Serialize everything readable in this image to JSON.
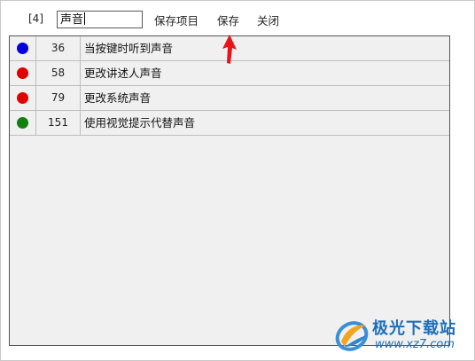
{
  "toolbar": {
    "count_label": "[4]",
    "search_value": "声音",
    "save_item_label": "保存项目",
    "save_label": "保存",
    "close_label": "关闭"
  },
  "list": {
    "rows": [
      {
        "dot_color": "#0000e0",
        "number": "36",
        "text": "当按键时听到声音"
      },
      {
        "dot_color": "#e00000",
        "number": "58",
        "text": "更改讲述人声音"
      },
      {
        "dot_color": "#e00000",
        "number": "79",
        "text": "更改系统声音"
      },
      {
        "dot_color": "#118011",
        "number": "151",
        "text": "使用视觉提示代替声音"
      }
    ]
  },
  "watermark": {
    "title": "极光下载站",
    "url": "www.xz7.com",
    "logo_icon": "aurora-swirl-logo"
  },
  "annotation": {
    "arrow_color": "#e8141b",
    "arrow_icon": "red-up-arrow"
  }
}
